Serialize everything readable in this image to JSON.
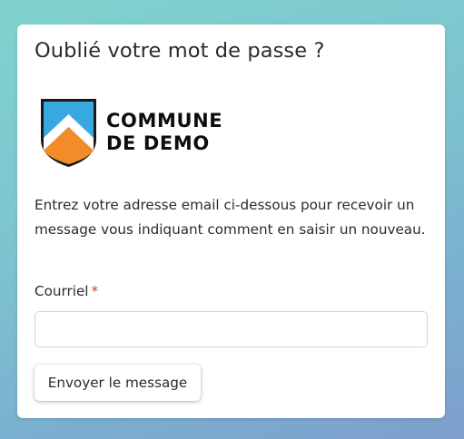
{
  "page": {
    "title": "Oublié votre mot de passe ?"
  },
  "logo": {
    "line1": "COMMUNE",
    "line2": "DE DEMO",
    "icon": "shield-crest-icon",
    "colors": {
      "sky": "#3aa8e0",
      "mountain": "#f28c28",
      "outline": "#1a1a1a"
    }
  },
  "form": {
    "description": "Entrez votre adresse email ci-dessous pour recevoir un message vous indiquant comment en saisir un nouveau.",
    "email_label": "Courriel",
    "required_mark": "*",
    "email_value": "",
    "submit_label": "Envoyer le message"
  },
  "colors": {
    "required": "#d9352b",
    "background_gradient": [
      "#7fd3cf",
      "#7f9fcd"
    ]
  }
}
